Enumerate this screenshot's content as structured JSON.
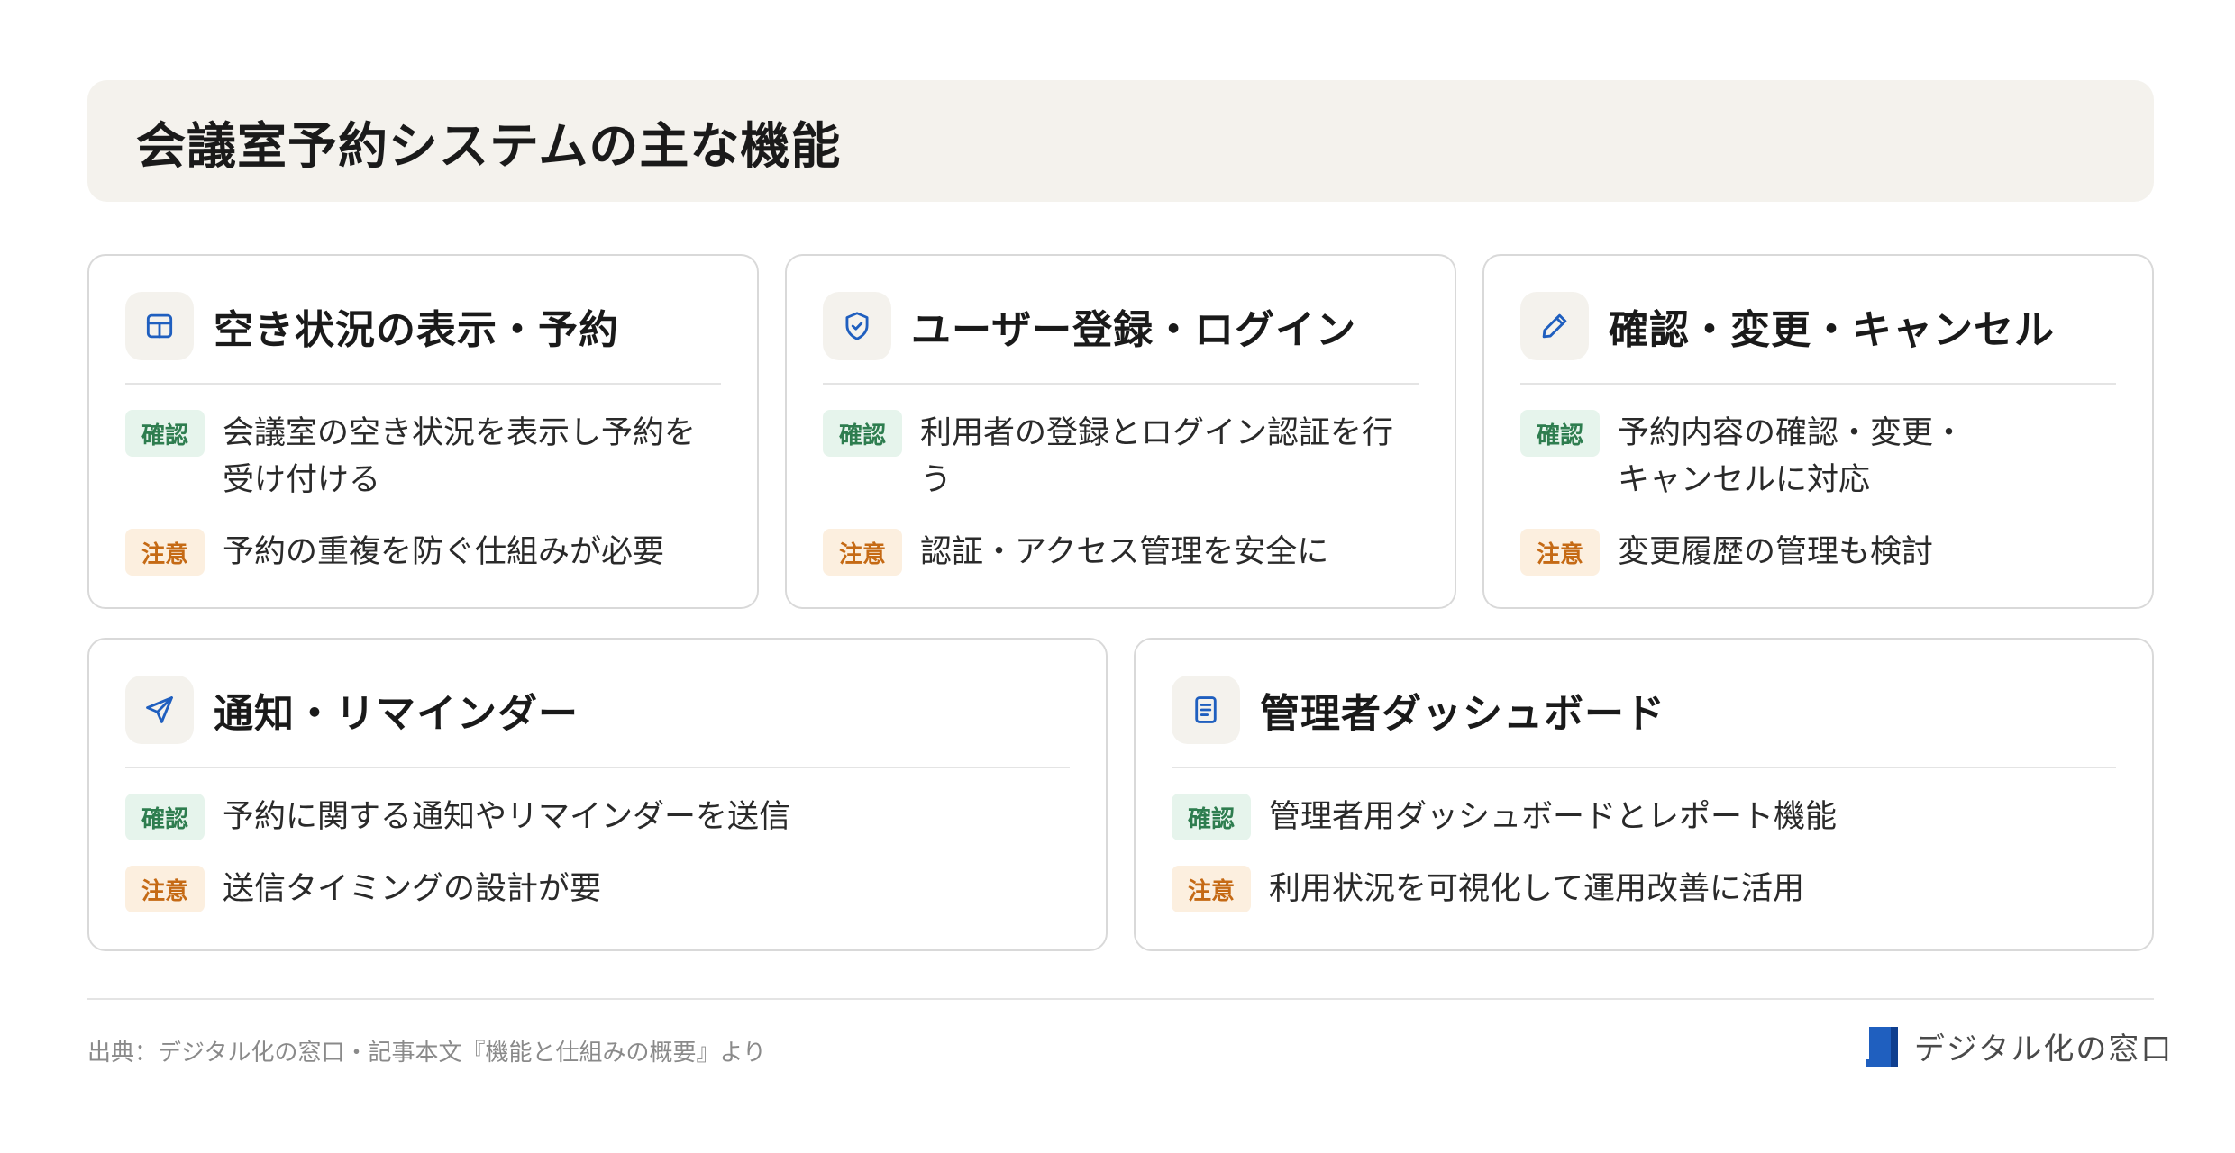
{
  "title": "会議室予約システムの主な機能",
  "labels": {
    "confirm": "確認",
    "caution": "注意"
  },
  "cards": [
    {
      "title": "空き状況の表示・予約",
      "icon": "table-icon",
      "confirm": "会議室の空き状況を表示し予約を\n受け付ける",
      "caution": "予約の重複を防ぐ仕組みが必要"
    },
    {
      "title": "ユーザー登録・ログイン",
      "icon": "shield-check-icon",
      "confirm": "利用者の登録とログイン認証を行う",
      "caution": "認証・アクセス管理を安全に"
    },
    {
      "title": "確認・変更・キャンセル",
      "icon": "pencil-icon",
      "confirm": "予約内容の確認・変更・\nキャンセルに対応",
      "caution": "変更履歴の管理も検討"
    },
    {
      "title": "通知・リマインダー",
      "icon": "send-icon",
      "confirm": "予約に関する通知やリマインダーを送信",
      "caution": "送信タイミングの設計が要"
    },
    {
      "title": "管理者ダッシュボード",
      "icon": "document-icon",
      "confirm": "管理者用ダッシュボードとレポート機能",
      "caution": "利用状況を可視化して運用改善に活用"
    }
  ],
  "footer": {
    "source": "出典：デジタル化の窓口・記事本文『機能と仕組みの概要』より",
    "brand": "デジタル化の窓口"
  },
  "colors": {
    "accent": "#1f5fbf",
    "confirm_bg": "#e6f4ec",
    "confirm_text": "#2e7d4f",
    "caution_bg": "#fcefdf",
    "caution_text": "#c56a15",
    "panel_bg": "#f4f2ed"
  }
}
